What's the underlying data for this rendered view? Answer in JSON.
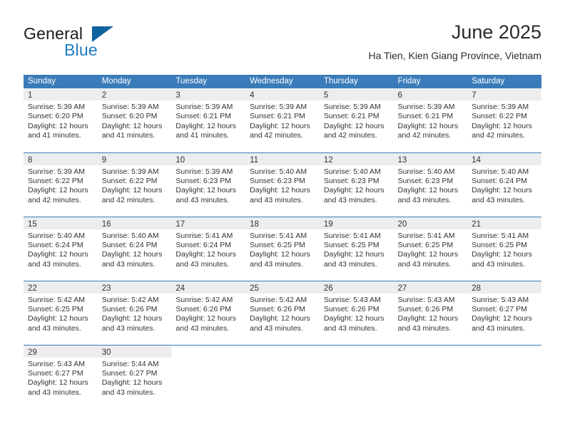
{
  "brand": {
    "name_part1": "General",
    "name_part2": "Blue",
    "triangle_icon": "brand-triangle-icon",
    "colors": {
      "dark": "#1b1b1b",
      "blue": "#1d7dc2",
      "triangle": "#11639f"
    }
  },
  "header": {
    "title": "June 2025",
    "subtitle": "Ha Tien, Kien Giang Province, Vietnam"
  },
  "theme": {
    "header_band": "#3a7cb9",
    "date_band": "#ededed",
    "row_rule": "#3a7cb9",
    "text": "#333333"
  },
  "calendar": {
    "weekday_headers": [
      "Sunday",
      "Monday",
      "Tuesday",
      "Wednesday",
      "Thursday",
      "Friday",
      "Saturday"
    ],
    "weeks": [
      [
        {
          "date": "1",
          "sunrise": "Sunrise: 5:39 AM",
          "sunset": "Sunset: 6:20 PM",
          "daylight_line1": "Daylight: 12 hours",
          "daylight_line2": "and 41 minutes."
        },
        {
          "date": "2",
          "sunrise": "Sunrise: 5:39 AM",
          "sunset": "Sunset: 6:20 PM",
          "daylight_line1": "Daylight: 12 hours",
          "daylight_line2": "and 41 minutes."
        },
        {
          "date": "3",
          "sunrise": "Sunrise: 5:39 AM",
          "sunset": "Sunset: 6:21 PM",
          "daylight_line1": "Daylight: 12 hours",
          "daylight_line2": "and 41 minutes."
        },
        {
          "date": "4",
          "sunrise": "Sunrise: 5:39 AM",
          "sunset": "Sunset: 6:21 PM",
          "daylight_line1": "Daylight: 12 hours",
          "daylight_line2": "and 42 minutes."
        },
        {
          "date": "5",
          "sunrise": "Sunrise: 5:39 AM",
          "sunset": "Sunset: 6:21 PM",
          "daylight_line1": "Daylight: 12 hours",
          "daylight_line2": "and 42 minutes."
        },
        {
          "date": "6",
          "sunrise": "Sunrise: 5:39 AM",
          "sunset": "Sunset: 6:21 PM",
          "daylight_line1": "Daylight: 12 hours",
          "daylight_line2": "and 42 minutes."
        },
        {
          "date": "7",
          "sunrise": "Sunrise: 5:39 AM",
          "sunset": "Sunset: 6:22 PM",
          "daylight_line1": "Daylight: 12 hours",
          "daylight_line2": "and 42 minutes."
        }
      ],
      [
        {
          "date": "8",
          "sunrise": "Sunrise: 5:39 AM",
          "sunset": "Sunset: 6:22 PM",
          "daylight_line1": "Daylight: 12 hours",
          "daylight_line2": "and 42 minutes."
        },
        {
          "date": "9",
          "sunrise": "Sunrise: 5:39 AM",
          "sunset": "Sunset: 6:22 PM",
          "daylight_line1": "Daylight: 12 hours",
          "daylight_line2": "and 42 minutes."
        },
        {
          "date": "10",
          "sunrise": "Sunrise: 5:39 AM",
          "sunset": "Sunset: 6:23 PM",
          "daylight_line1": "Daylight: 12 hours",
          "daylight_line2": "and 43 minutes."
        },
        {
          "date": "11",
          "sunrise": "Sunrise: 5:40 AM",
          "sunset": "Sunset: 6:23 PM",
          "daylight_line1": "Daylight: 12 hours",
          "daylight_line2": "and 43 minutes."
        },
        {
          "date": "12",
          "sunrise": "Sunrise: 5:40 AM",
          "sunset": "Sunset: 6:23 PM",
          "daylight_line1": "Daylight: 12 hours",
          "daylight_line2": "and 43 minutes."
        },
        {
          "date": "13",
          "sunrise": "Sunrise: 5:40 AM",
          "sunset": "Sunset: 6:23 PM",
          "daylight_line1": "Daylight: 12 hours",
          "daylight_line2": "and 43 minutes."
        },
        {
          "date": "14",
          "sunrise": "Sunrise: 5:40 AM",
          "sunset": "Sunset: 6:24 PM",
          "daylight_line1": "Daylight: 12 hours",
          "daylight_line2": "and 43 minutes."
        }
      ],
      [
        {
          "date": "15",
          "sunrise": "Sunrise: 5:40 AM",
          "sunset": "Sunset: 6:24 PM",
          "daylight_line1": "Daylight: 12 hours",
          "daylight_line2": "and 43 minutes."
        },
        {
          "date": "16",
          "sunrise": "Sunrise: 5:40 AM",
          "sunset": "Sunset: 6:24 PM",
          "daylight_line1": "Daylight: 12 hours",
          "daylight_line2": "and 43 minutes."
        },
        {
          "date": "17",
          "sunrise": "Sunrise: 5:41 AM",
          "sunset": "Sunset: 6:24 PM",
          "daylight_line1": "Daylight: 12 hours",
          "daylight_line2": "and 43 minutes."
        },
        {
          "date": "18",
          "sunrise": "Sunrise: 5:41 AM",
          "sunset": "Sunset: 6:25 PM",
          "daylight_line1": "Daylight: 12 hours",
          "daylight_line2": "and 43 minutes."
        },
        {
          "date": "19",
          "sunrise": "Sunrise: 5:41 AM",
          "sunset": "Sunset: 6:25 PM",
          "daylight_line1": "Daylight: 12 hours",
          "daylight_line2": "and 43 minutes."
        },
        {
          "date": "20",
          "sunrise": "Sunrise: 5:41 AM",
          "sunset": "Sunset: 6:25 PM",
          "daylight_line1": "Daylight: 12 hours",
          "daylight_line2": "and 43 minutes."
        },
        {
          "date": "21",
          "sunrise": "Sunrise: 5:41 AM",
          "sunset": "Sunset: 6:25 PM",
          "daylight_line1": "Daylight: 12 hours",
          "daylight_line2": "and 43 minutes."
        }
      ],
      [
        {
          "date": "22",
          "sunrise": "Sunrise: 5:42 AM",
          "sunset": "Sunset: 6:25 PM",
          "daylight_line1": "Daylight: 12 hours",
          "daylight_line2": "and 43 minutes."
        },
        {
          "date": "23",
          "sunrise": "Sunrise: 5:42 AM",
          "sunset": "Sunset: 6:26 PM",
          "daylight_line1": "Daylight: 12 hours",
          "daylight_line2": "and 43 minutes."
        },
        {
          "date": "24",
          "sunrise": "Sunrise: 5:42 AM",
          "sunset": "Sunset: 6:26 PM",
          "daylight_line1": "Daylight: 12 hours",
          "daylight_line2": "and 43 minutes."
        },
        {
          "date": "25",
          "sunrise": "Sunrise: 5:42 AM",
          "sunset": "Sunset: 6:26 PM",
          "daylight_line1": "Daylight: 12 hours",
          "daylight_line2": "and 43 minutes."
        },
        {
          "date": "26",
          "sunrise": "Sunrise: 5:43 AM",
          "sunset": "Sunset: 6:26 PM",
          "daylight_line1": "Daylight: 12 hours",
          "daylight_line2": "and 43 minutes."
        },
        {
          "date": "27",
          "sunrise": "Sunrise: 5:43 AM",
          "sunset": "Sunset: 6:26 PM",
          "daylight_line1": "Daylight: 12 hours",
          "daylight_line2": "and 43 minutes."
        },
        {
          "date": "28",
          "sunrise": "Sunrise: 5:43 AM",
          "sunset": "Sunset: 6:27 PM",
          "daylight_line1": "Daylight: 12 hours",
          "daylight_line2": "and 43 minutes."
        }
      ],
      [
        {
          "date": "29",
          "sunrise": "Sunrise: 5:43 AM",
          "sunset": "Sunset: 6:27 PM",
          "daylight_line1": "Daylight: 12 hours",
          "daylight_line2": "and 43 minutes."
        },
        {
          "date": "30",
          "sunrise": "Sunrise: 5:44 AM",
          "sunset": "Sunset: 6:27 PM",
          "daylight_line1": "Daylight: 12 hours",
          "daylight_line2": "and 43 minutes."
        },
        {
          "date": "",
          "sunrise": "",
          "sunset": "",
          "daylight_line1": "",
          "daylight_line2": ""
        },
        {
          "date": "",
          "sunrise": "",
          "sunset": "",
          "daylight_line1": "",
          "daylight_line2": ""
        },
        {
          "date": "",
          "sunrise": "",
          "sunset": "",
          "daylight_line1": "",
          "daylight_line2": ""
        },
        {
          "date": "",
          "sunrise": "",
          "sunset": "",
          "daylight_line1": "",
          "daylight_line2": ""
        },
        {
          "date": "",
          "sunrise": "",
          "sunset": "",
          "daylight_line1": "",
          "daylight_line2": ""
        }
      ]
    ]
  }
}
